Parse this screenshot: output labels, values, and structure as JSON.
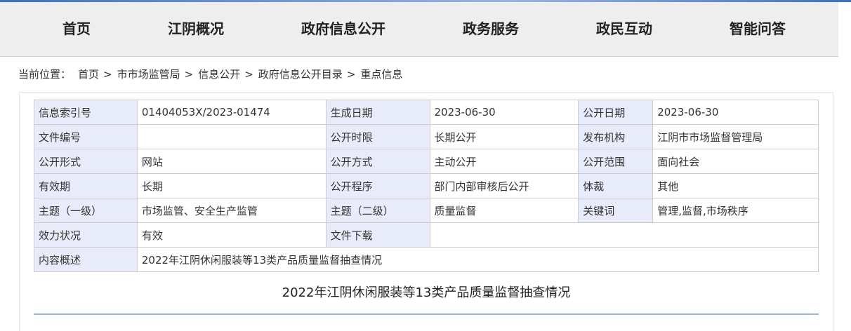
{
  "nav": {
    "items": [
      "首页",
      "江阴概况",
      "政府信息公开",
      "政务服务",
      "政民互动",
      "智能问答"
    ]
  },
  "breadcrumb": {
    "prefix": "当前位置：",
    "items": [
      "首页",
      "市市场监管局",
      "信息公开",
      "政府信息公开目录",
      "重点信息"
    ],
    "separator": ">"
  },
  "meta": {
    "index_no_label": "信息索引号",
    "index_no": "01404053X/2023-01474",
    "created_label": "生成日期",
    "created": "2023-06-30",
    "published_label": "公开日期",
    "published": "2023-06-30",
    "doc_no_label": "文件编号",
    "doc_no": "",
    "time_limit_label": "公开时限",
    "time_limit": "长期公开",
    "issuer_label": "发布机构",
    "issuer": "江阴市市场监督管理局",
    "form_label": "公开形式",
    "form": "网站",
    "method_label": "公开方式",
    "method": "主动公开",
    "scope_label": "公开范围",
    "scope": "面向社会",
    "validity_label": "有效期",
    "validity": "长期",
    "procedure_label": "公开程序",
    "procedure": "部门内部审核后公开",
    "genre_label": "体裁",
    "genre": "其他",
    "topic1_label": "主题（一级）",
    "topic1": "市场监管、安全生产监管",
    "topic2_label": "主题（二级）",
    "topic2": "质量监督",
    "keywords_label": "关键词",
    "keywords": "管理,监督,市场秩序",
    "effect_label": "效力状况",
    "effect": "有效",
    "download_label": "文件下载",
    "download": "",
    "summary_label": "内容概述",
    "summary": "2022年江阴休闲服装等13类产品质量监督抽查情况"
  },
  "article": {
    "title": "2022年江阴休闲服装等13类产品质量监督抽查情况"
  },
  "colors": {
    "label_bg": "#e8ecfa",
    "nav_bg": "#eeeeee",
    "rule": "#9db3ee"
  }
}
